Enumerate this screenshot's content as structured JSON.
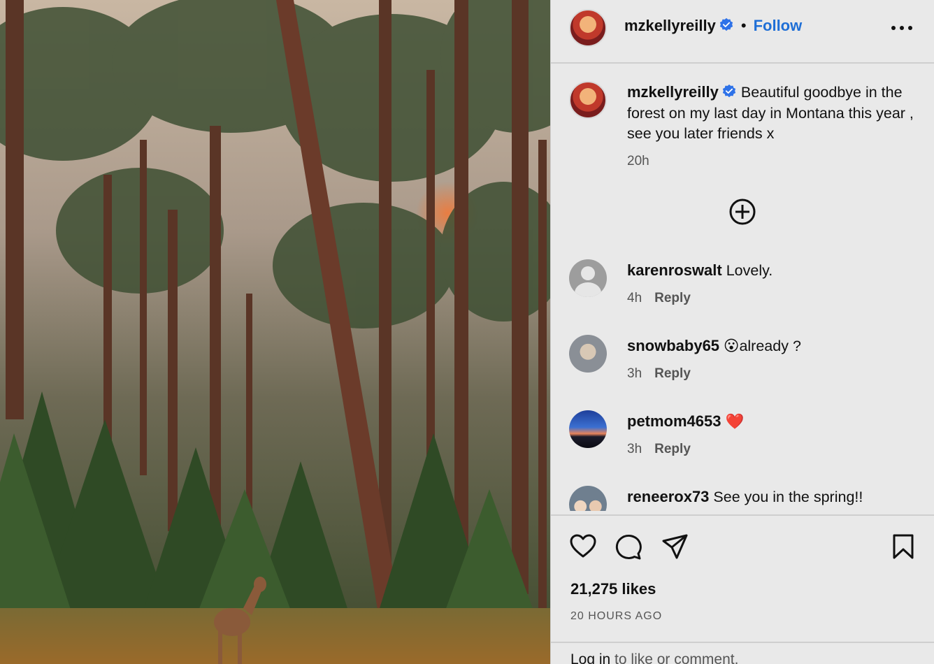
{
  "header": {
    "username": "mzkellyreilly",
    "separator": "•",
    "follow_label": "Follow",
    "more_icon": "more-options-icon"
  },
  "caption": {
    "username": "mzkellyreilly",
    "text": "Beautiful goodbye in the forest on my last day in Montana this year , see you later friends x",
    "time": "20h"
  },
  "comments": [
    {
      "username": "karenroswalt",
      "text": "Lovely.",
      "time": "4h",
      "reply_label": "Reply"
    },
    {
      "username": "snowbaby65",
      "text": "already ?",
      "emoji": "😮",
      "time": "3h",
      "reply_label": "Reply"
    },
    {
      "username": "petmom4653",
      "text": "",
      "emoji": "❤️",
      "time": "3h",
      "reply_label": "Reply"
    },
    {
      "username": "reneerox73",
      "text": "See you in the spring!!"
    }
  ],
  "actions": {
    "likes": "21,275 likes",
    "date": "20 HOURS AGO",
    "icons": [
      "heart-icon",
      "comment-icon",
      "share-icon",
      "bookmark-icon"
    ]
  },
  "login": {
    "link_label": "Log in",
    "suffix": " to like or comment."
  },
  "colors": {
    "accent": "#1f6fd6",
    "verified": "#2e72e8",
    "background": "#e9e9e9",
    "heart": "#d92e2e"
  }
}
